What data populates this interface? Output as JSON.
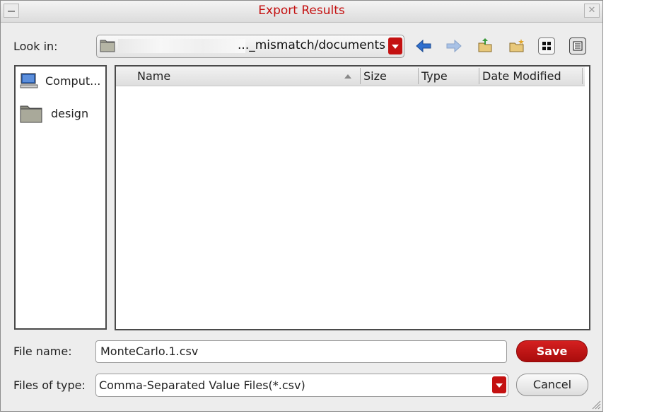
{
  "dialog": {
    "title": "Export Results"
  },
  "look_in": {
    "label": "Look in:",
    "path": "..._mismatch/documents"
  },
  "places": [
    {
      "label": "Comput...",
      "icon": "computer-icon"
    },
    {
      "label": "design",
      "icon": "folder-icon"
    }
  ],
  "file_list": {
    "columns": [
      "Name",
      "Size",
      "Type",
      "Date Modified"
    ],
    "sort_indicator": "ascending",
    "rows": []
  },
  "file_name": {
    "label": "File name:",
    "value": "MonteCarlo.1.csv"
  },
  "file_type": {
    "label": "Files of type:",
    "value": "Comma-Separated Value Files(*.csv)"
  },
  "buttons": {
    "save": "Save",
    "cancel": "Cancel"
  },
  "colors": {
    "accent": "#c41111"
  }
}
